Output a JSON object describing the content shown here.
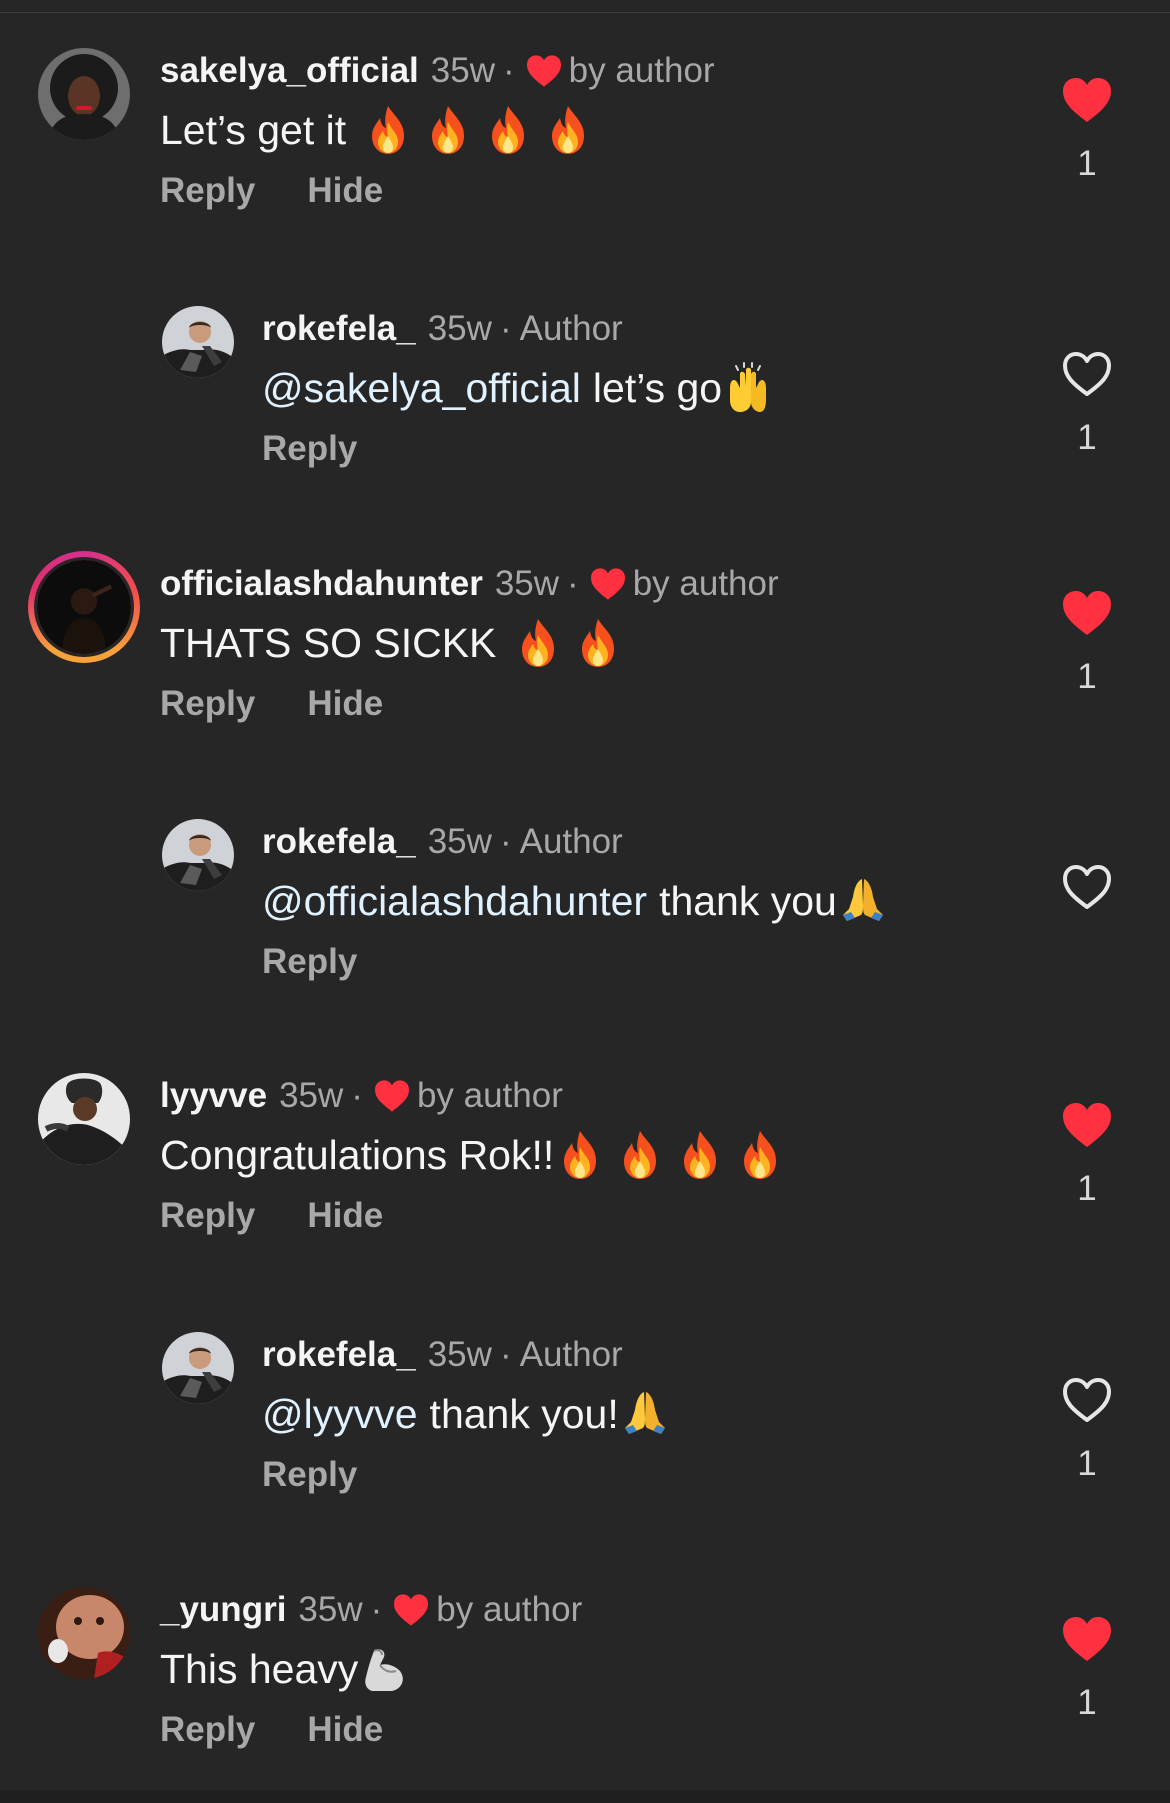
{
  "colors": {
    "background": "#262626",
    "heart_red": "#ff3040",
    "muted_text": "#a8a8a8",
    "mention": "#e0f1ff"
  },
  "comments": [
    {
      "username": "sakelya_official",
      "time": "35w",
      "badge": "by author",
      "text": "Let’s get it",
      "emojis": [
        "fire-emoji",
        "fire-emoji",
        "fire-emoji",
        "fire-emoji"
      ],
      "reply_label": "Reply",
      "hide_label": "Hide",
      "liked": true,
      "like_count": "1"
    },
    {
      "username": "rokefela_",
      "time": "35w",
      "badge": "Author",
      "mention": "@sakelya_official",
      "text": "let’s go",
      "emojis": [
        "raising-hands-emoji"
      ],
      "reply_label": "Reply",
      "liked": false,
      "like_count": "1"
    },
    {
      "username": "officialashdahunter",
      "time": "35w",
      "badge": "by author",
      "text": "THATS SO SICKK",
      "emojis": [
        "fire-emoji",
        "fire-emoji"
      ],
      "reply_label": "Reply",
      "hide_label": "Hide",
      "liked": true,
      "like_count": "1"
    },
    {
      "username": "rokefela_",
      "time": "35w",
      "badge": "Author",
      "mention": "@officialashdahunter",
      "text": "thank you",
      "emojis": [
        "folded-hands-emoji"
      ],
      "reply_label": "Reply",
      "liked": false,
      "like_count": ""
    },
    {
      "username": "lyyvve",
      "time": "35w",
      "badge": "by author",
      "text": "Congratulations Rok!!",
      "emojis": [
        "fire-emoji",
        "fire-emoji",
        "fire-emoji",
        "fire-emoji"
      ],
      "reply_label": "Reply",
      "hide_label": "Hide",
      "liked": true,
      "like_count": "1"
    },
    {
      "username": "rokefela_",
      "time": "35w",
      "badge": "Author",
      "mention": "@lyyvve",
      "text": "thank you!",
      "emojis": [
        "folded-hands-emoji"
      ],
      "reply_label": "Reply",
      "liked": false,
      "like_count": "1"
    },
    {
      "username": "_yungri",
      "time": "35w",
      "badge": "by author",
      "text": "This heavy",
      "emojis": [
        "flexed-biceps-emoji"
      ],
      "reply_label": "Reply",
      "hide_label": "Hide",
      "liked": true,
      "like_count": "1"
    }
  ]
}
